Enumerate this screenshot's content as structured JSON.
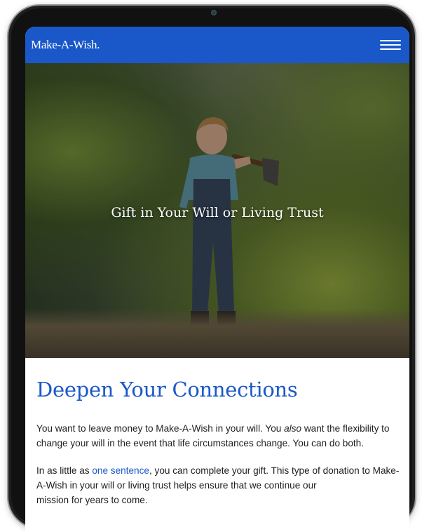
{
  "header": {
    "logo_text": "Make-A-Wish.",
    "logo_icon": "wishing-star-swoosh",
    "menu_icon": "hamburger-menu-icon",
    "brand_color": "#1a58c9"
  },
  "hero": {
    "title": "Gift in Your Will or Living Trust"
  },
  "main": {
    "heading": "Deepen Your Connections",
    "paragraph1": {
      "before_em": "You want to leave money to Make-A-Wish in your will. You ",
      "em": "also",
      "after_em": " want the flexibility to change your will in the event that life circumstances change. You can do both."
    },
    "paragraph2": {
      "before_link": "In as little as ",
      "link": "one sentence",
      "after_link": ", you can complete your gift. This type of donation to Make-A-Wish in your will or living trust helps ensure that we continue our",
      "cut_off": "mission for years to come."
    }
  }
}
